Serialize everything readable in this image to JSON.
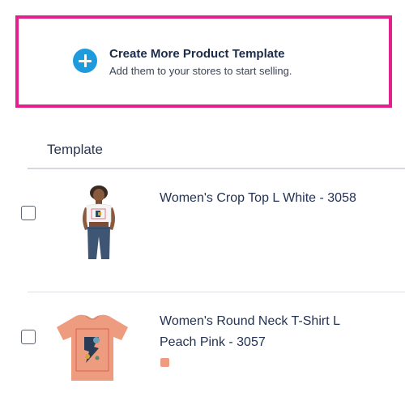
{
  "cta": {
    "title": "Create More Product Template",
    "subtitle": "Add them to your stores to start selling.",
    "icon": "plus-circle-icon",
    "border_color": "#e4208f",
    "icon_color": "#1d9bdc"
  },
  "table": {
    "column_header": "Template",
    "rows": [
      {
        "name": "Women's Crop Top L White - 3058",
        "image": "crop-top-product-image"
      },
      {
        "name": "Women's Round Neck T-Shirt L Peach Pink - 3057",
        "image": "round-neck-tshirt-product-image",
        "color_swatch": "#ee9c7f"
      }
    ]
  }
}
